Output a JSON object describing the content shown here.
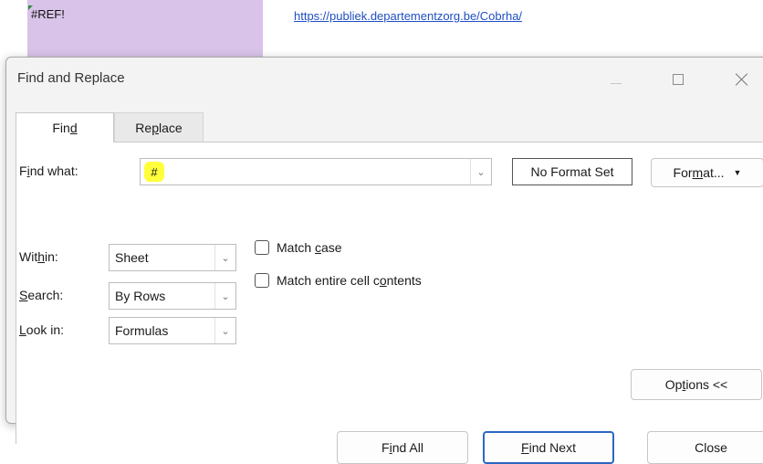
{
  "sheet": {
    "cell_text": "#REF!",
    "link_text": "https://publiek.departementzorg.be/Cobrha/"
  },
  "dialog": {
    "title": "Find and Replace",
    "tabs": [
      {
        "label": "Find",
        "accel": "d",
        "selected": true
      },
      {
        "label": "Replace",
        "accel": "p",
        "selected": false
      }
    ],
    "find_what": {
      "label": "Find what:",
      "value": "#"
    },
    "preview": "No Format Set",
    "format_button": "Format...",
    "within": {
      "label": "Within:",
      "value": "Sheet"
    },
    "search": {
      "label": "Search:",
      "value": "By Rows"
    },
    "look_in": {
      "label": "Look in:",
      "value": "Formulas"
    },
    "match_case": {
      "label": "Match case",
      "checked": false
    },
    "match_entire": {
      "label": "Match entire cell contents",
      "checked": false
    },
    "options_button": "Options <<",
    "find_all_button": "Find All",
    "find_next_button": "Find Next",
    "close_button": "Close"
  },
  "colors": {
    "highlight": "#ffff3c",
    "cell_fill": "#d9c3e9",
    "link": "#1f4fc2",
    "default_button_border": "#2b66c4"
  }
}
